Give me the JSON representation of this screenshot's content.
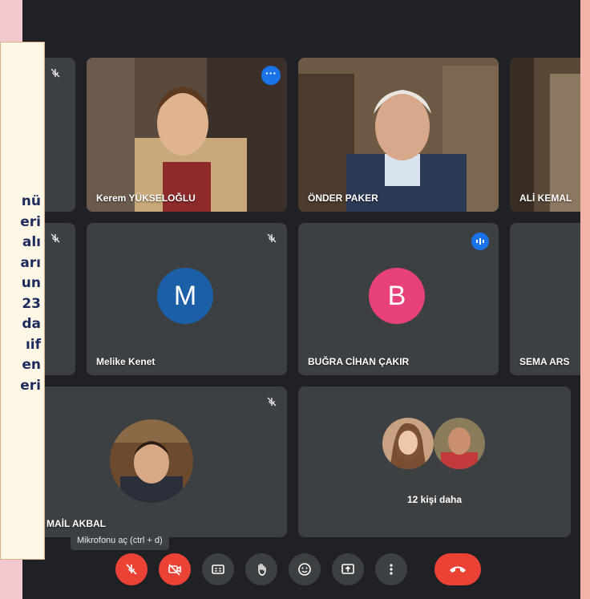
{
  "note": {
    "lines": [
      "nü",
      "eri",
      "alı",
      "arı",
      "un",
      "23",
      "da",
      "ıif",
      "en",
      "eri"
    ]
  },
  "participants": {
    "kerem": {
      "name": "Kerem YÜKSELOĞLU"
    },
    "onder": {
      "name": "ÖNDER PAKER"
    },
    "ali": {
      "name": "ALİ KEMAL"
    },
    "melike": {
      "name": "Melike Kenet",
      "initial": "M",
      "color": "#1a5fa8"
    },
    "bugra": {
      "name": "BUĞRA CİHAN ÇAKIR",
      "initial": "B",
      "color": "#e8407a"
    },
    "sema": {
      "name": "SEMA ARS"
    },
    "ismail": {
      "name": "MAİL AKBAL"
    },
    "more": {
      "label": "12 kişi daha"
    }
  },
  "tooltip": "Mikrofonu aç (ctrl + d)",
  "colors": {
    "accent": "#1a73e8",
    "danger": "#ea4335",
    "tile": "#3c4043",
    "bg": "#202124"
  },
  "controls": [
    "microphone-off-icon",
    "camera-off-icon",
    "captions-icon",
    "raise-hand-icon",
    "emoji-icon",
    "present-icon",
    "more-options-icon",
    "end-call-icon"
  ]
}
